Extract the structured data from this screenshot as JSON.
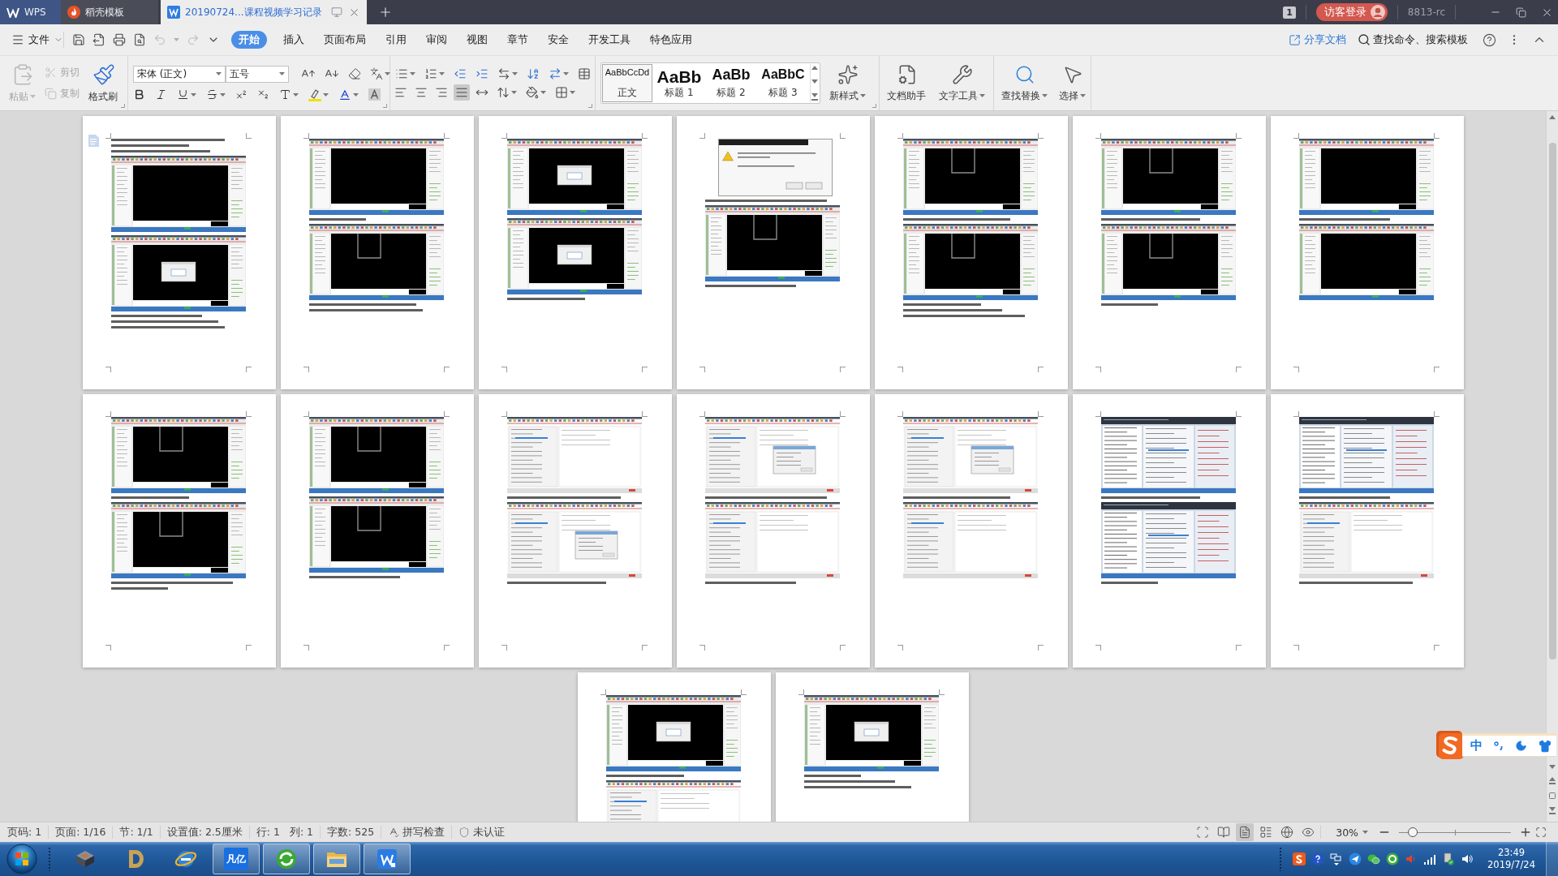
{
  "title_bar": {
    "tabs": [
      {
        "kind": "app",
        "label": "WPS",
        "selected": false
      },
      {
        "kind": "template",
        "label": "稻壳模板",
        "selected": false
      },
      {
        "kind": "document",
        "label": "20190724...课程视频学习记录",
        "selected": true
      }
    ],
    "window_count": "1",
    "login": "访客登录",
    "user_id": "8813-rc"
  },
  "menu_bar": {
    "file": "文件",
    "quick_access": [
      {
        "kind": "save",
        "disabled": false
      },
      {
        "kind": "export",
        "disabled": false
      },
      {
        "kind": "print",
        "disabled": false
      },
      {
        "kind": "preview",
        "disabled": false
      },
      {
        "kind": "undo",
        "disabled": true
      },
      {
        "kind": "redo",
        "disabled": true
      },
      {
        "kind": "customize",
        "disabled": false
      }
    ],
    "tabs": [
      {
        "label": "开始",
        "selected": true
      },
      {
        "label": "插入",
        "selected": false
      },
      {
        "label": "页面布局",
        "selected": false
      },
      {
        "label": "引用",
        "selected": false
      },
      {
        "label": "审阅",
        "selected": false
      },
      {
        "label": "视图",
        "selected": false
      },
      {
        "label": "章节",
        "selected": false
      },
      {
        "label": "安全",
        "selected": false
      },
      {
        "label": "开发工具",
        "selected": false
      },
      {
        "label": "特色应用",
        "selected": false
      }
    ],
    "share": "分享文档",
    "command_search": "查找命令、搜索模板"
  },
  "ribbon": {
    "paste": {
      "label": "粘贴",
      "disabled": true
    },
    "clipboard": [
      {
        "kind": "cut",
        "label": "剪切",
        "disabled": true
      },
      {
        "kind": "copy",
        "label": "复制",
        "disabled": true
      }
    ],
    "format_painter": {
      "label": "格式刷",
      "disabled": false
    },
    "font_name": "宋体 (正文)",
    "font_size": "五号",
    "alignment": [
      {
        "kind": "left",
        "selected": false
      },
      {
        "kind": "center",
        "selected": false
      },
      {
        "kind": "right",
        "selected": false
      },
      {
        "kind": "justify",
        "selected": true
      },
      {
        "kind": "distributed",
        "selected": false
      }
    ],
    "styles": [
      {
        "kind": "body",
        "sample": "AaBbCcDd",
        "label": "正文",
        "selected": true
      },
      {
        "kind": "h1",
        "sample": "AaBb",
        "label": "标题 1",
        "selected": false
      },
      {
        "kind": "h2",
        "sample": "AaBb",
        "label": "标题 2",
        "selected": false
      },
      {
        "kind": "h3",
        "sample": "AaBbC",
        "label": "标题 3",
        "selected": false
      }
    ],
    "new_style": {
      "label": "新样式",
      "dropdown": true
    },
    "tool_groups": [
      [
        {
          "kind": "assistant",
          "label": "文档助手",
          "dropdown": false
        },
        {
          "kind": "text-tools",
          "label": "文字工具",
          "dropdown": true
        }
      ],
      [
        {
          "kind": "find",
          "label": "查找替换",
          "dropdown": true
        },
        {
          "kind": "select",
          "label": "选择",
          "dropdown": true
        }
      ]
    ]
  },
  "pages": [
    {
      "marker": true,
      "blocks": [
        {
          "kind": "text"
        },
        {
          "kind": "text"
        },
        {
          "kind": "text"
        },
        {
          "kind": "cad"
        },
        {
          "kind": "cad-dialog"
        },
        {
          "kind": "text"
        },
        {
          "kind": "text"
        },
        {
          "kind": "text"
        }
      ]
    },
    {
      "marker": false,
      "blocks": [
        {
          "kind": "cad"
        },
        {
          "kind": "text"
        },
        {
          "kind": "cad-shape"
        },
        {
          "kind": "text"
        },
        {
          "kind": "text"
        }
      ]
    },
    {
      "marker": false,
      "blocks": [
        {
          "kind": "cad-dialog"
        },
        {
          "kind": "cad-dialog"
        },
        {
          "kind": "text"
        }
      ]
    },
    {
      "marker": false,
      "blocks": [
        {
          "kind": "warning"
        },
        {
          "kind": "text"
        },
        {
          "kind": "cad-shape"
        },
        {
          "kind": "text"
        }
      ]
    },
    {
      "marker": false,
      "blocks": [
        {
          "kind": "cad-shape"
        },
        {
          "kind": "text"
        },
        {
          "kind": "cad-shape"
        },
        {
          "kind": "text"
        },
        {
          "kind": "text"
        },
        {
          "kind": "text"
        }
      ]
    },
    {
      "marker": false,
      "blocks": [
        {
          "kind": "cad-shape"
        },
        {
          "kind": "text"
        },
        {
          "kind": "cad-shape"
        },
        {
          "kind": "text"
        }
      ]
    },
    {
      "marker": false,
      "blocks": [
        {
          "kind": "cad"
        },
        {
          "kind": "text"
        },
        {
          "kind": "cad"
        }
      ]
    },
    {
      "marker": false,
      "blocks": [
        {
          "kind": "cad-shape"
        },
        {
          "kind": "text"
        },
        {
          "kind": "cad-shape"
        },
        {
          "kind": "text"
        },
        {
          "kind": "text"
        }
      ]
    },
    {
      "marker": false,
      "blocks": [
        {
          "kind": "cad-shape"
        },
        {
          "kind": "cad-shape"
        },
        {
          "kind": "text"
        }
      ]
    },
    {
      "marker": false,
      "blocks": [
        {
          "kind": "list"
        },
        {
          "kind": "text"
        },
        {
          "kind": "list-dialog"
        },
        {
          "kind": "text"
        }
      ]
    },
    {
      "marker": false,
      "blocks": [
        {
          "kind": "list-dialog"
        },
        {
          "kind": "text"
        },
        {
          "kind": "list"
        },
        {
          "kind": "text"
        }
      ]
    },
    {
      "marker": false,
      "blocks": [
        {
          "kind": "list-dialog"
        },
        {
          "kind": "text"
        },
        {
          "kind": "list"
        }
      ]
    },
    {
      "marker": false,
      "blocks": [
        {
          "kind": "dense"
        },
        {
          "kind": "text"
        },
        {
          "kind": "dense"
        },
        {
          "kind": "text"
        }
      ]
    },
    {
      "marker": false,
      "blocks": [
        {
          "kind": "dense"
        },
        {
          "kind": "text"
        },
        {
          "kind": "list"
        },
        {
          "kind": "text"
        }
      ]
    },
    {
      "marker": false,
      "blocks": [
        {
          "kind": "cad-dialog"
        },
        {
          "kind": "text"
        },
        {
          "kind": "list"
        }
      ]
    },
    {
      "marker": false,
      "blocks": [
        {
          "kind": "cad-dialog"
        },
        {
          "kind": "text"
        },
        {
          "kind": "text"
        },
        {
          "kind": "text"
        }
      ]
    }
  ],
  "ime_bar": {
    "mode": "中"
  },
  "status_bar": {
    "groups": [
      [
        "页码: 1"
      ],
      [
        "页面: 1/16"
      ],
      [
        "节: 1/1"
      ],
      [
        "设置值: 2.5厘米"
      ],
      [
        "行: 1",
        "列: 1"
      ],
      [
        "字数: 525"
      ]
    ],
    "spell_check": "拼写检查",
    "certification": "未认证",
    "views": [
      {
        "kind": "fullscreen",
        "selected": false
      },
      {
        "kind": "reading",
        "selected": false
      },
      {
        "kind": "page",
        "selected": true
      },
      {
        "kind": "outline",
        "selected": false
      },
      {
        "kind": "web",
        "selected": false
      },
      {
        "kind": "eye-care",
        "selected": false
      }
    ],
    "zoom": "30%",
    "zoom_slider": {
      "level": 0.12
    }
  },
  "taskbar": {
    "apps": [
      {
        "kind": "device",
        "running": false
      },
      {
        "kind": "gold-logo",
        "running": false
      },
      {
        "kind": "globe",
        "running": false
      },
      {
        "kind": "tile",
        "label": "凡亿",
        "running": true
      },
      {
        "kind": "green-circle",
        "running": true
      },
      {
        "kind": "folder",
        "running": true
      },
      {
        "kind": "writer",
        "running": true
      }
    ],
    "time": "23:49",
    "date": "2019/7/24"
  }
}
